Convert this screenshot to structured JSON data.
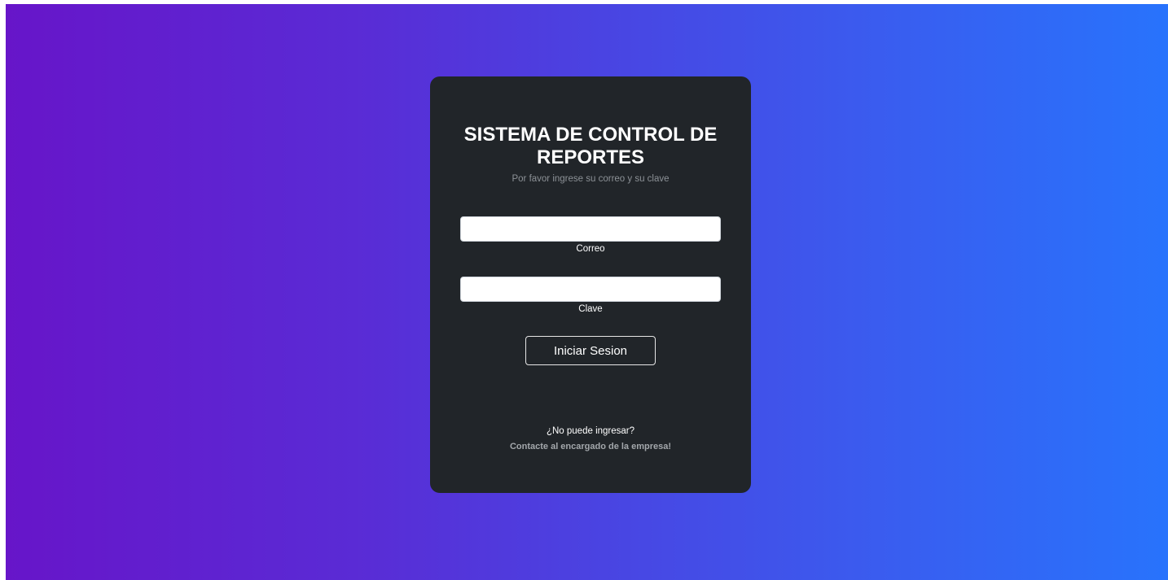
{
  "login": {
    "title": "SISTEMA DE CONTROL DE REPORTES",
    "subtitle": "Por favor ingrese su correo y su clave",
    "email": {
      "label": "Correo",
      "value": ""
    },
    "password": {
      "label": "Clave",
      "value": ""
    },
    "submit_label": "Iniciar Sesion",
    "help_question": "¿No puede ingresar?",
    "help_contact": "Contacte al encargado de la empresa!"
  },
  "colors": {
    "gradient_start": "#6715c9",
    "gradient_end": "#2873fc",
    "card_bg": "#212529",
    "text_primary": "#ffffff",
    "text_muted": "#8c9196"
  }
}
